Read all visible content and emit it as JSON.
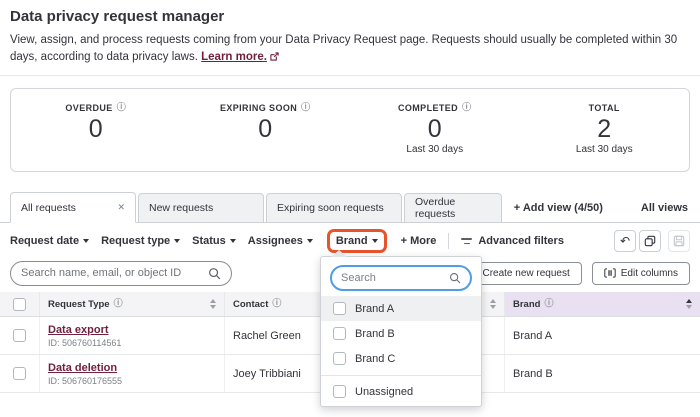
{
  "page": {
    "title": "Data privacy request manager",
    "description": "View, assign, and process requests coming from your Data Privacy Request page. Requests should usually be completed within 30 days, according to data privacy laws.",
    "learn_more": "Learn more."
  },
  "stats": [
    {
      "label": "OVERDUE",
      "value": "0",
      "sub": ""
    },
    {
      "label": "EXPIRING SOON",
      "value": "0",
      "sub": ""
    },
    {
      "label": "COMPLETED",
      "value": "0",
      "sub": "Last 30 days"
    },
    {
      "label": "TOTAL",
      "value": "2",
      "sub": "Last 30 days"
    }
  ],
  "tabs": {
    "items": [
      "All requests",
      "New requests",
      "Expiring soon requests",
      "Overdue requests"
    ],
    "add_view": "+ Add view (4/50)",
    "all_views": "All views"
  },
  "filters": {
    "chips": [
      "Request date",
      "Request type",
      "Status",
      "Assignees",
      "Brand"
    ],
    "more": "+ More",
    "advanced": "Advanced filters"
  },
  "toolbar": {
    "search_placeholder": "Search name, email, or object ID",
    "create_button": "Create new request",
    "edit_columns": "Edit columns"
  },
  "dropdown": {
    "search_placeholder": "Search",
    "options": [
      "Brand A",
      "Brand B",
      "Brand C"
    ],
    "unassigned": "Unassigned"
  },
  "table": {
    "columns": [
      "Request Type",
      "Contact",
      "",
      "Brand"
    ],
    "rows": [
      {
        "type": "Data export",
        "id": "ID: 506760114561",
        "contact": "Rachel Green",
        "brand": "Brand A"
      },
      {
        "type": "Data deletion",
        "id": "ID: 506760176555",
        "contact": "Joey Tribbiani",
        "brand": "Brand B"
      }
    ]
  },
  "colors": {
    "annotation_orange": "#e8532c",
    "focus_blue": "#4f9de8",
    "link_maroon": "#701f3c",
    "brand_header_bg": "#e9e1f1"
  }
}
